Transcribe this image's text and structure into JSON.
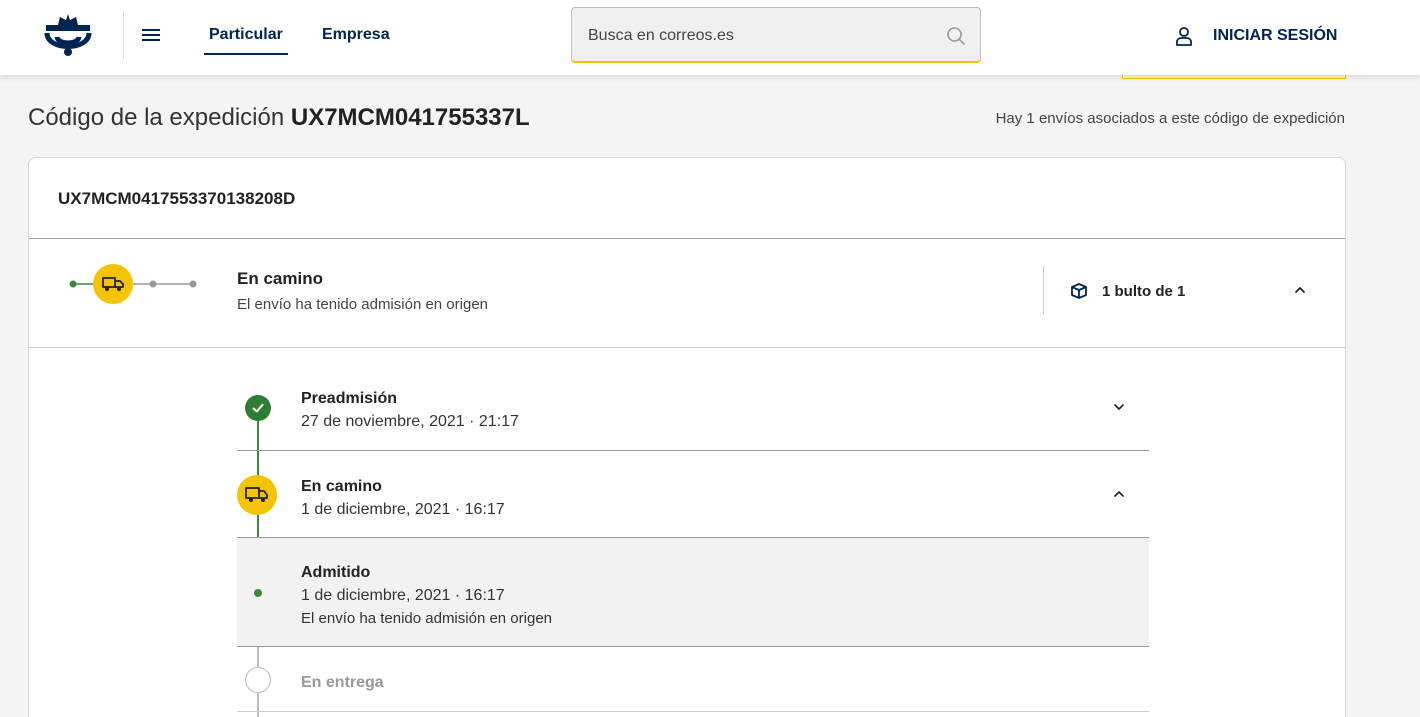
{
  "header": {
    "nav": {
      "particular": "Particular",
      "empresa": "Empresa"
    },
    "search": {
      "placeholder": "Busca en correos.es"
    },
    "login_label": "INICIAR SESIÓN"
  },
  "expedition": {
    "title_prefix": "Código de la expedición",
    "code": "UX7MCM041755337L",
    "associated_text": "Hay 1 envíos asociados a este código de expedición"
  },
  "shipment": {
    "code": "UX7MCM0417553370138208D",
    "status_title": "En camino",
    "status_subtitle": "El envío ha tenido admisión en origen",
    "packages_label": "1 bulto de 1"
  },
  "timeline": {
    "events": [
      {
        "title": "Preadmisión",
        "date": "27 de noviembre, 2021 · 21:17",
        "state": "completed"
      },
      {
        "title": "En camino",
        "date": "1 de diciembre, 2021 · 16:17",
        "state": "current"
      },
      {
        "title": "En entrega",
        "state": "pending"
      }
    ],
    "sub_event": {
      "title": "Admitido",
      "date": "1 de diciembre, 2021 · 16:17",
      "description": "El envío ha tenido admisión en origen"
    }
  },
  "colors": {
    "brand_blue": "#002453",
    "brand_yellow": "#f5c400",
    "success_green": "#2e7d32",
    "pending_grey": "#bbbbbb"
  },
  "icons": [
    "correos-logo-icon",
    "menu-icon",
    "search-icon",
    "user-icon",
    "truck-icon",
    "package-icon",
    "chevron-up-icon",
    "chevron-down-icon",
    "check-icon"
  ]
}
